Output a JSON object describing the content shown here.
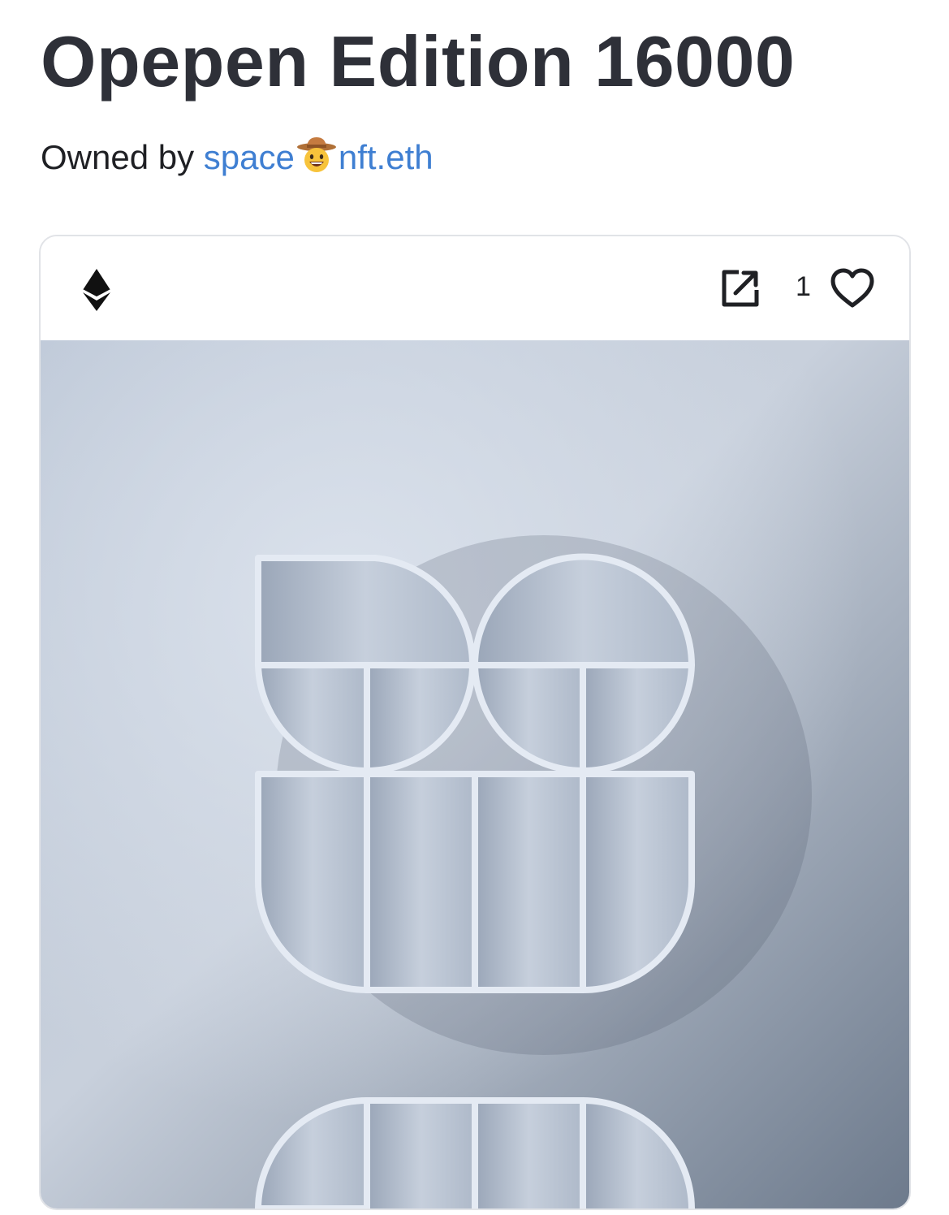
{
  "page": {
    "title": "Opepen Edition 16000"
  },
  "owner": {
    "prefix": "Owned by",
    "name_start": "space",
    "name_emoji": "cowboy-hat-face-emoji",
    "name_end": "nft.eth"
  },
  "card": {
    "chain_icon": "ethereum-icon",
    "external_icon": "external-link-icon",
    "like_count": "1",
    "like_icon": "heart-outline-icon"
  },
  "colors": {
    "title_text": "#2e3038",
    "link": "#3f7fd2",
    "card_border": "#e1e3e7",
    "artwork_background": "#a8b3c4",
    "artwork_shelf": "#dfe6f0"
  }
}
